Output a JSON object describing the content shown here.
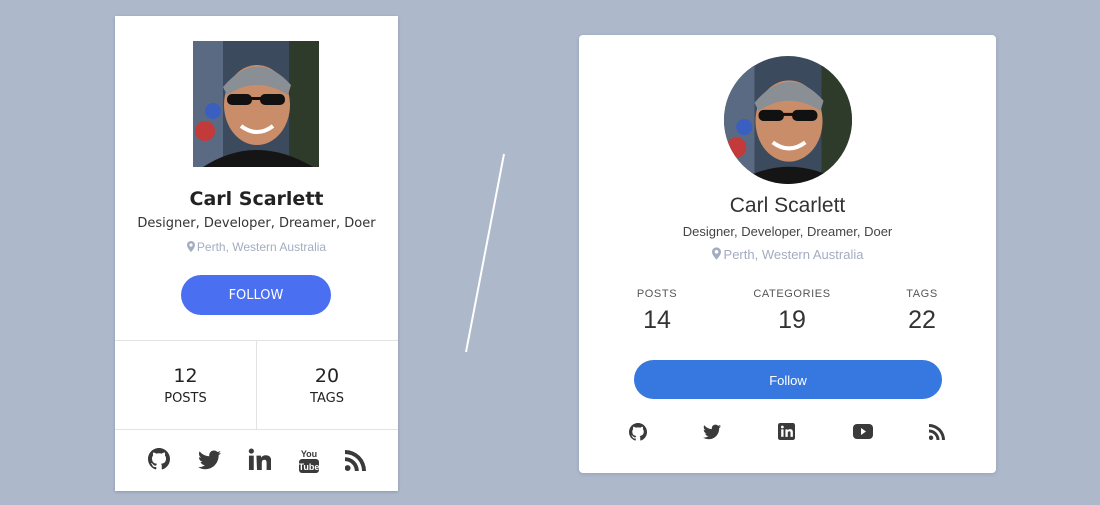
{
  "cards": [
    {
      "name": "Carl Scarlett",
      "role": "Designer, Developer, Dreamer, Doer",
      "location": "Perth, Western Australia",
      "follow_label": "FOLLOW",
      "stats": [
        {
          "value": "12",
          "label": "POSTS"
        },
        {
          "value": "20",
          "label": "TAGS"
        }
      ],
      "social_icons": [
        "github-icon",
        "twitter-icon",
        "linkedin-icon",
        "youtube-icon",
        "rss-icon"
      ]
    },
    {
      "name": "Carl Scarlett",
      "role": "Designer, Developer, Dreamer, Doer",
      "location": "Perth, Western Australia",
      "follow_label": "Follow",
      "stats": [
        {
          "value": "14",
          "label": "POSTS"
        },
        {
          "value": "19",
          "label": "CATEGORIES"
        },
        {
          "value": "22",
          "label": "TAGS"
        }
      ],
      "social_icons": [
        "github-icon",
        "twitter-icon",
        "linkedin-icon",
        "youtube-icon",
        "rss-icon"
      ]
    }
  ],
  "colors": {
    "background": "#adb8cb",
    "card1_follow": "#4a6ff0",
    "card2_follow": "#3777e0",
    "location_text": "#a4acc0",
    "icon": "#3a3a3a"
  }
}
